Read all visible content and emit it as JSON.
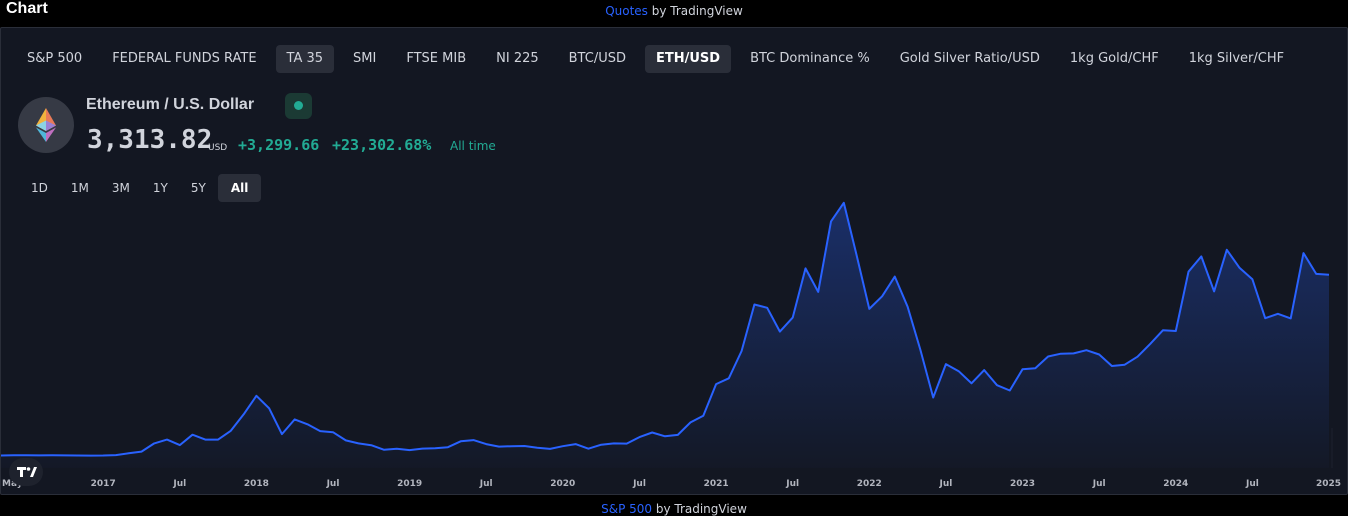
{
  "header": {
    "title": "Chart",
    "attribution_link": "Quotes",
    "attribution_text": " by TradingView",
    "bottom_link": "S&P 500",
    "bottom_text": " by TradingView"
  },
  "tabs": [
    {
      "label": "S&P 500",
      "state": "normal"
    },
    {
      "label": "FEDERAL FUNDS RATE",
      "state": "normal"
    },
    {
      "label": "TA 35",
      "state": "muted"
    },
    {
      "label": "SMI",
      "state": "normal"
    },
    {
      "label": "FTSE MIB",
      "state": "normal"
    },
    {
      "label": "NI 225",
      "state": "normal"
    },
    {
      "label": "BTC/USD",
      "state": "normal"
    },
    {
      "label": "ETH/USD",
      "state": "active"
    },
    {
      "label": "BTC Dominance %",
      "state": "normal"
    },
    {
      "label": "Gold Silver Ratio/USD",
      "state": "normal"
    },
    {
      "label": "1kg Gold/CHF",
      "state": "normal"
    },
    {
      "label": "1kg Silver/CHF",
      "state": "normal"
    }
  ],
  "symbol": {
    "logo_icon": "ethereum-icon",
    "name": "Ethereum / U.S. Dollar",
    "status_icon": "market-open-dot-icon",
    "price": "3,313.82",
    "currency": "USD",
    "change_abs": "+3,299.66",
    "change_pct": "+23,302.68%",
    "change_period": "All time"
  },
  "ranges": [
    {
      "label": "1D",
      "active": false
    },
    {
      "label": "1M",
      "active": false
    },
    {
      "label": "3M",
      "active": false
    },
    {
      "label": "1Y",
      "active": false
    },
    {
      "label": "5Y",
      "active": false
    },
    {
      "label": "All",
      "active": true
    }
  ],
  "colors": {
    "background": "#131722",
    "line": "#2962ff",
    "positive": "#22ab94",
    "text": "#d1d4dc"
  },
  "chart_data": {
    "type": "area",
    "title": "",
    "xlabel": "",
    "ylabel": "",
    "grid": false,
    "x_ticks": [
      "May",
      "2017",
      "Jul",
      "2018",
      "Jul",
      "2019",
      "Jul",
      "2020",
      "Jul",
      "2021",
      "Jul",
      "2022",
      "Jul",
      "2023",
      "Jul",
      "2024",
      "Jul",
      "2025"
    ],
    "x_tick_dates": [
      "2016-05",
      "2017-01",
      "2017-07",
      "2018-01",
      "2018-07",
      "2019-01",
      "2019-07",
      "2020-01",
      "2020-07",
      "2021-01",
      "2021-07",
      "2022-01",
      "2022-07",
      "2023-01",
      "2023-07",
      "2024-01",
      "2024-07",
      "2025-01"
    ],
    "ylim": [
      0,
      4900
    ],
    "series": [
      {
        "values": [
          {
            "x": "2016-05",
            "y": 10
          },
          {
            "x": "2016-06",
            "y": 12
          },
          {
            "x": "2016-07",
            "y": 12
          },
          {
            "x": "2016-08",
            "y": 11
          },
          {
            "x": "2016-09",
            "y": 12
          },
          {
            "x": "2016-10",
            "y": 11
          },
          {
            "x": "2016-11",
            "y": 9
          },
          {
            "x": "2016-12",
            "y": 8
          },
          {
            "x": "2017-01",
            "y": 10
          },
          {
            "x": "2017-02",
            "y": 16
          },
          {
            "x": "2017-03",
            "y": 50
          },
          {
            "x": "2017-04",
            "y": 80
          },
          {
            "x": "2017-05",
            "y": 230
          },
          {
            "x": "2017-06",
            "y": 300
          },
          {
            "x": "2017-07",
            "y": 200
          },
          {
            "x": "2017-08",
            "y": 390
          },
          {
            "x": "2017-09",
            "y": 300
          },
          {
            "x": "2017-10",
            "y": 300
          },
          {
            "x": "2017-11",
            "y": 460
          },
          {
            "x": "2017-12",
            "y": 760
          },
          {
            "x": "2018-01",
            "y": 1100
          },
          {
            "x": "2018-02",
            "y": 870
          },
          {
            "x": "2018-03",
            "y": 400
          },
          {
            "x": "2018-04",
            "y": 670
          },
          {
            "x": "2018-05",
            "y": 580
          },
          {
            "x": "2018-06",
            "y": 455
          },
          {
            "x": "2018-07",
            "y": 435
          },
          {
            "x": "2018-08",
            "y": 285
          },
          {
            "x": "2018-09",
            "y": 230
          },
          {
            "x": "2018-10",
            "y": 198
          },
          {
            "x": "2018-11",
            "y": 113
          },
          {
            "x": "2018-12",
            "y": 133
          },
          {
            "x": "2019-01",
            "y": 107
          },
          {
            "x": "2019-02",
            "y": 136
          },
          {
            "x": "2019-03",
            "y": 141
          },
          {
            "x": "2019-04",
            "y": 160
          },
          {
            "x": "2019-05",
            "y": 268
          },
          {
            "x": "2019-06",
            "y": 290
          },
          {
            "x": "2019-07",
            "y": 218
          },
          {
            "x": "2019-08",
            "y": 172
          },
          {
            "x": "2019-09",
            "y": 180
          },
          {
            "x": "2019-10",
            "y": 182
          },
          {
            "x": "2019-11",
            "y": 151
          },
          {
            "x": "2019-12",
            "y": 129
          },
          {
            "x": "2020-01",
            "y": 180
          },
          {
            "x": "2020-02",
            "y": 218
          },
          {
            "x": "2020-03",
            "y": 133
          },
          {
            "x": "2020-04",
            "y": 207
          },
          {
            "x": "2020-05",
            "y": 231
          },
          {
            "x": "2020-06",
            "y": 226
          },
          {
            "x": "2020-07",
            "y": 345
          },
          {
            "x": "2020-08",
            "y": 430
          },
          {
            "x": "2020-09",
            "y": 360
          },
          {
            "x": "2020-10",
            "y": 385
          },
          {
            "x": "2020-11",
            "y": 615
          },
          {
            "x": "2020-12",
            "y": 737
          },
          {
            "x": "2021-01",
            "y": 1315
          },
          {
            "x": "2021-02",
            "y": 1420
          },
          {
            "x": "2021-03",
            "y": 1920
          },
          {
            "x": "2021-04",
            "y": 2770
          },
          {
            "x": "2021-05",
            "y": 2710
          },
          {
            "x": "2021-06",
            "y": 2275
          },
          {
            "x": "2021-07",
            "y": 2530
          },
          {
            "x": "2021-08",
            "y": 3430
          },
          {
            "x": "2021-09",
            "y": 3000
          },
          {
            "x": "2021-10",
            "y": 4290
          },
          {
            "x": "2021-11",
            "y": 4630
          },
          {
            "x": "2021-12",
            "y": 3680
          },
          {
            "x": "2022-01",
            "y": 2690
          },
          {
            "x": "2022-02",
            "y": 2920
          },
          {
            "x": "2022-03",
            "y": 3280
          },
          {
            "x": "2022-04",
            "y": 2730
          },
          {
            "x": "2022-05",
            "y": 1940
          },
          {
            "x": "2022-06",
            "y": 1070
          },
          {
            "x": "2022-07",
            "y": 1680
          },
          {
            "x": "2022-08",
            "y": 1550
          },
          {
            "x": "2022-09",
            "y": 1330
          },
          {
            "x": "2022-10",
            "y": 1570
          },
          {
            "x": "2022-11",
            "y": 1295
          },
          {
            "x": "2022-12",
            "y": 1197
          },
          {
            "x": "2023-01",
            "y": 1585
          },
          {
            "x": "2023-02",
            "y": 1605
          },
          {
            "x": "2023-03",
            "y": 1820
          },
          {
            "x": "2023-04",
            "y": 1870
          },
          {
            "x": "2023-05",
            "y": 1875
          },
          {
            "x": "2023-06",
            "y": 1935
          },
          {
            "x": "2023-07",
            "y": 1855
          },
          {
            "x": "2023-08",
            "y": 1645
          },
          {
            "x": "2023-09",
            "y": 1670
          },
          {
            "x": "2023-10",
            "y": 1815
          },
          {
            "x": "2023-11",
            "y": 2050
          },
          {
            "x": "2023-12",
            "y": 2300
          },
          {
            "x": "2024-01",
            "y": 2285
          },
          {
            "x": "2024-02",
            "y": 3370
          },
          {
            "x": "2024-03",
            "y": 3650
          },
          {
            "x": "2024-04",
            "y": 3010
          },
          {
            "x": "2024-05",
            "y": 3770
          },
          {
            "x": "2024-06",
            "y": 3440
          },
          {
            "x": "2024-07",
            "y": 3230
          },
          {
            "x": "2024-08",
            "y": 2520
          },
          {
            "x": "2024-09",
            "y": 2600
          },
          {
            "x": "2024-10",
            "y": 2515
          },
          {
            "x": "2024-11",
            "y": 3710
          },
          {
            "x": "2024-12",
            "y": 3330
          },
          {
            "x": "2025-01",
            "y": 3314
          }
        ]
      }
    ]
  }
}
